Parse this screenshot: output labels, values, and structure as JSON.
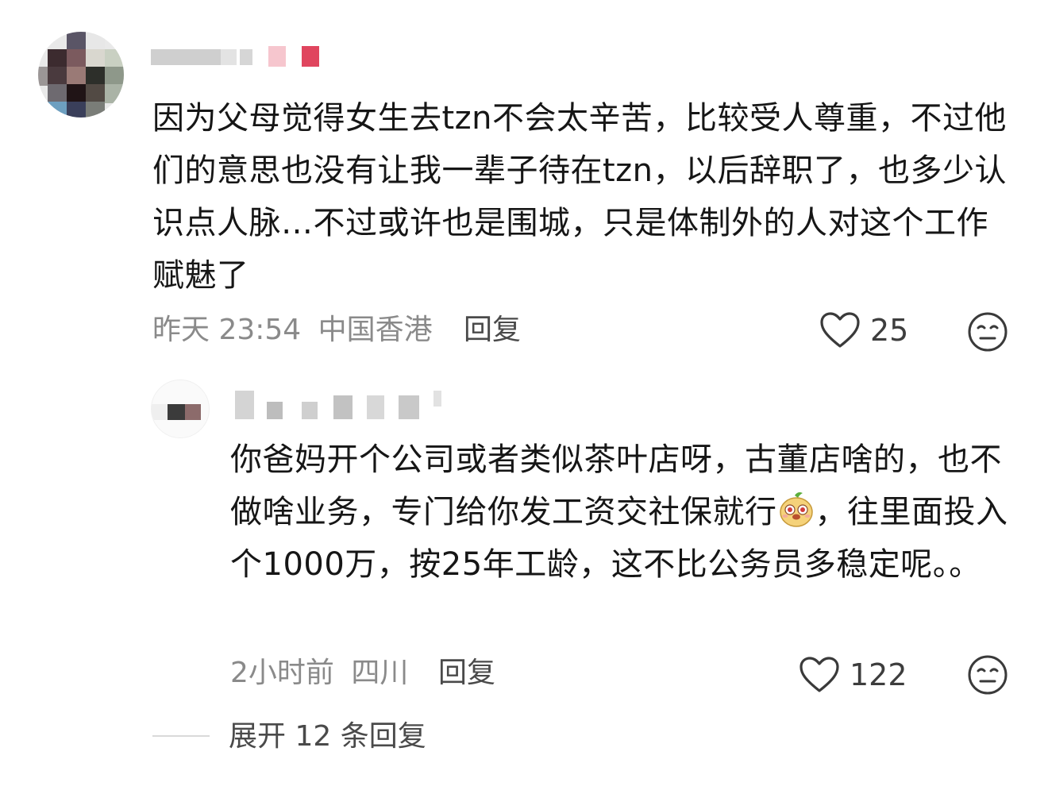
{
  "comment": {
    "text": "因为父母觉得女生去tzn不会太辛苦，比较受人尊重，不过他们的意思也没有让我一辈子待在tzn，以后辞职了，也多少认识点人脉…不过或许也是围城，只是体制外的人对这个工作赋魅了",
    "time": "昨天 23:54",
    "location": "中国香港",
    "reply_label": "回复",
    "like_count": "25",
    "like_icon": "heart-outline-icon",
    "dislike_icon": "meh-face-icon"
  },
  "reply": {
    "text_before_emoji": "你爸妈开个公司或者类似茶叶店呀，古董店啥的，也不做啥业务，专门给你发工资交社保就行",
    "emoji": "smiling-mascot-emoji",
    "text_after_emoji": "，往里面投入个1000万，按25年工龄，这不比公务员多稳定呢。。",
    "time": "2小时前",
    "location": "四川",
    "reply_label": "回复",
    "like_count": "122",
    "like_icon": "heart-outline-icon",
    "dislike_icon": "meh-face-icon"
  },
  "expand": {
    "label": "展开 12 条回复"
  },
  "colors": {
    "text": "#161616",
    "meta": "#8a8a8a",
    "action": "#4a4a4a",
    "name_badge": "#e0455e"
  }
}
